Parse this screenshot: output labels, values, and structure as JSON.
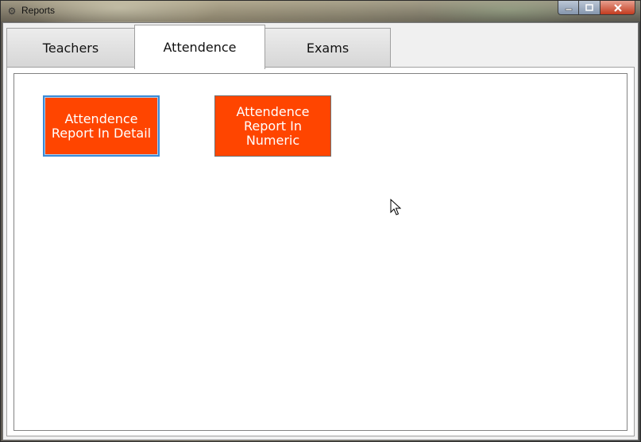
{
  "window": {
    "title": "Reports",
    "icon": "app-report-icon",
    "controls": {
      "minimize": "minimize-icon",
      "maximize": "maximize-icon",
      "close": "close-icon"
    }
  },
  "tabs": [
    {
      "label": "Teachers",
      "selected": false
    },
    {
      "label": "Attendence",
      "selected": true
    },
    {
      "label": "Exams",
      "selected": false
    }
  ],
  "panel": {
    "buttons": [
      {
        "label": "Attendence Report In Detail",
        "focused": true
      },
      {
        "label": "Attendence Report In Numeric",
        "focused": false
      }
    ]
  },
  "colors": {
    "button_bg": "#ff4500",
    "button_text": "#ffffff",
    "focus_border": "#3c8bd6"
  }
}
